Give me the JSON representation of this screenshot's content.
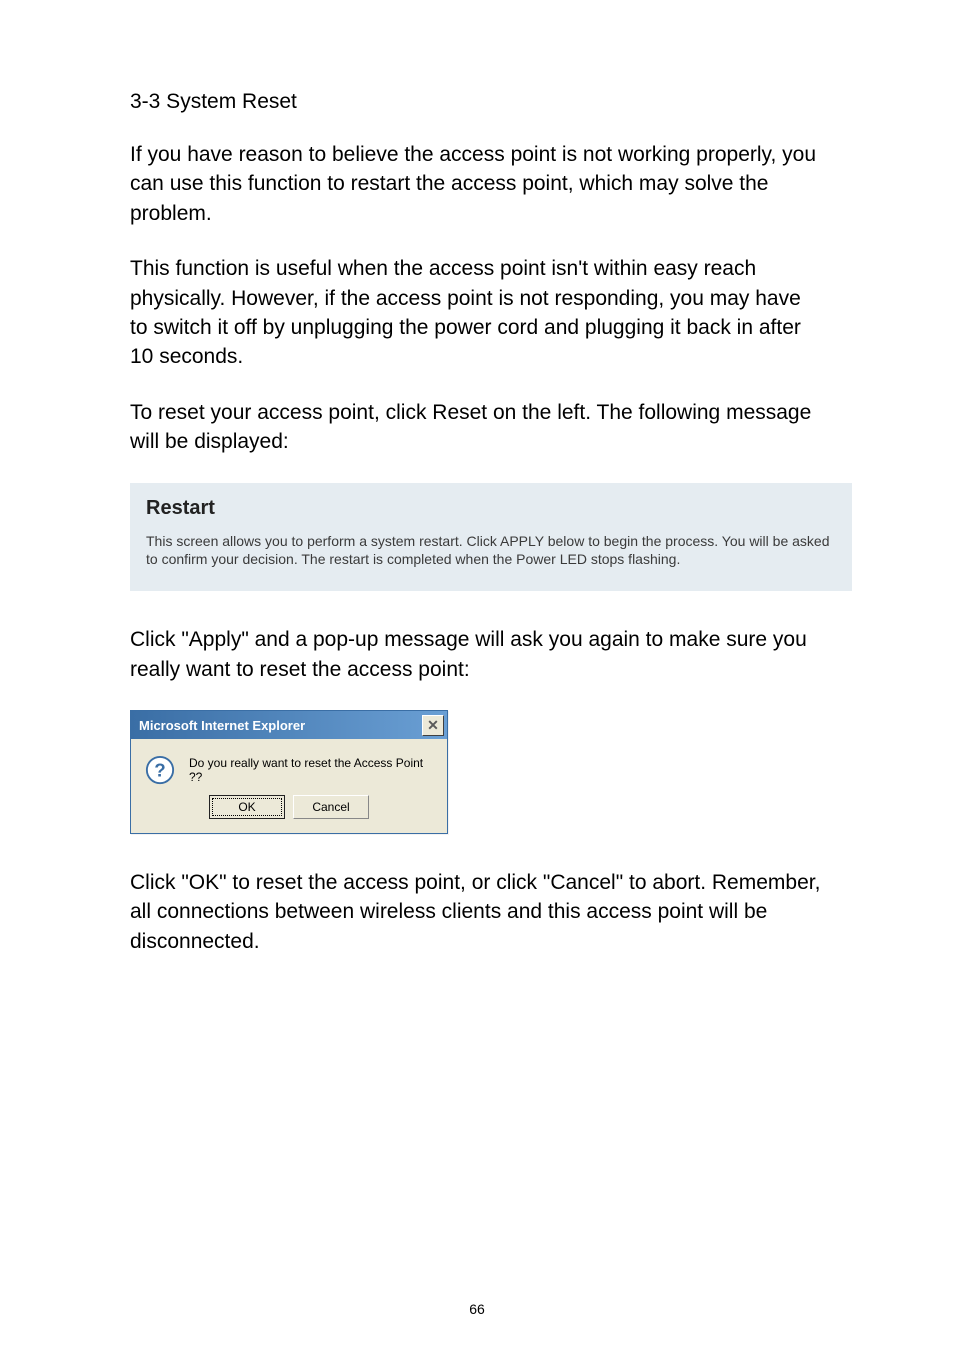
{
  "heading": "3-3 System Reset",
  "p1": "If you have reason to believe the access point is not working properly, you can use this function to restart the access point, which may solve the problem.",
  "p2": "This function is useful when the access point isn't within easy reach physically. However, if the access point is not responding, you may have to switch it off by unplugging the power cord and plugging it back in after 10 seconds.",
  "p3": "To reset your access point, click Reset on the left. The following message will be displayed:",
  "restart": {
    "title": "Restart",
    "body": "This screen allows you to perform a system restart. Click APPLY below to begin the process. You will be asked to confirm your decision. The restart is completed when the Power LED stops flashing."
  },
  "p4": "Click \"Apply\" and a pop-up message will ask you again to make sure you really want to reset the access point:",
  "dialog": {
    "title": "Microsoft Internet Explorer",
    "close": "✕",
    "message": "Do you really want to reset the Access Point ??",
    "ok": "OK",
    "cancel": "Cancel"
  },
  "p5": "Click \"OK\" to reset the access point, or click \"Cancel\" to abort. Remember, all connections between wireless clients and this access point will be disconnected.",
  "pageNumber": "66"
}
